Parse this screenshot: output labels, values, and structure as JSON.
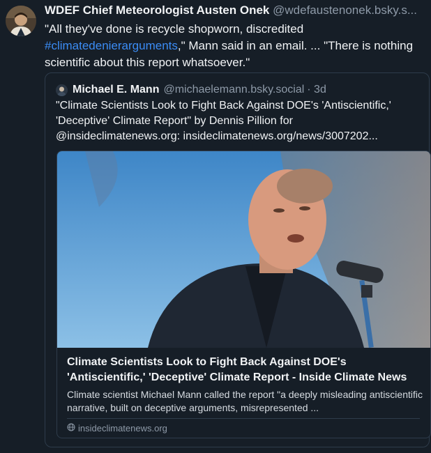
{
  "post": {
    "author_name": "WDEF Chief Meteorologist Austen Onek",
    "author_handle": "@wdefaustenonek.bsky.s...",
    "text_before": "\"All they've done is recycle shopworn, discredited ",
    "hashtag": "#climatedenierarguments",
    "text_after": ",\" Mann said in an email. ... \"There is nothing scientific about this report whatsoever.\""
  },
  "quote": {
    "author_name": "Michael E. Mann",
    "author_handle": "@michaelemann.bsky.social",
    "timestamp": "· 3d",
    "text": "\"Climate Scientists Look to Fight Back Against DOE's 'Antiscientific,' 'Deceptive' Climate Report\" by Dennis Pillion for @insideclimatenews.org: insideclimatenews.org/news/3007202...",
    "link_card": {
      "title": "Climate Scientists Look to Fight Back Against DOE's 'Antiscientific,' 'Deceptive' Climate Report - Inside Climate News",
      "description": "Climate scientist Michael Mann called the report \"a deeply misleading antiscientific narrative, built on deceptive arguments, misrepresented ...",
      "domain": "insideclimatenews.org",
      "image_icon": "photo-speaker-at-microphone"
    }
  },
  "colors": {
    "background": "#161e27",
    "link": "#3b8cf5",
    "muted": "#8e9aa8",
    "border": "#2e3c4b"
  }
}
